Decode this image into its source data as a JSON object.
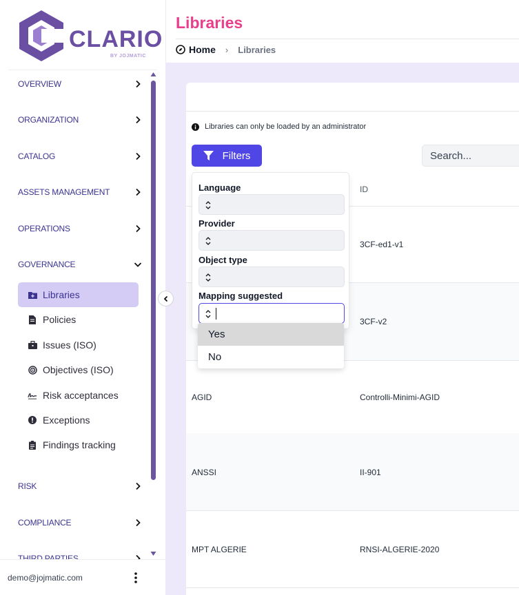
{
  "brand": {
    "name": "CLARIO",
    "tagline": "BY JOJMATIC",
    "color": "#6b4fa3"
  },
  "sidebar": {
    "sections": [
      {
        "label": "OVERVIEW",
        "expanded": false
      },
      {
        "label": "ORGANIZATION",
        "expanded": false
      },
      {
        "label": "CATALOG",
        "expanded": false
      },
      {
        "label": "ASSETS MANAGEMENT",
        "expanded": false
      },
      {
        "label": "OPERATIONS",
        "expanded": false
      },
      {
        "label": "GOVERNANCE",
        "expanded": true
      },
      {
        "label": "RISK",
        "expanded": false
      },
      {
        "label": "COMPLIANCE",
        "expanded": false
      },
      {
        "label": "THIRD PARTIES",
        "expanded": false
      }
    ],
    "governance_items": [
      {
        "label": "Libraries",
        "icon": "folder-plus-icon",
        "active": true
      },
      {
        "label": "Policies",
        "icon": "file-icon",
        "active": false
      },
      {
        "label": "Issues (ISO)",
        "icon": "briefcase-icon",
        "active": false
      },
      {
        "label": "Objectives (ISO)",
        "icon": "target-icon",
        "active": false
      },
      {
        "label": "Risk acceptances",
        "icon": "signature-icon",
        "active": false
      },
      {
        "label": "Exceptions",
        "icon": "exclamation-circle-icon",
        "active": false
      },
      {
        "label": "Findings tracking",
        "icon": "clipboard-icon",
        "active": false
      }
    ],
    "user_email": "demo@jojmatic.com"
  },
  "header": {
    "title": "Libraries",
    "breadcrumb": {
      "home": "Home",
      "separator": "›",
      "current": "Libraries"
    }
  },
  "main": {
    "info_text": "Libraries can only be loaded by an administrator",
    "filters_label": "Filters",
    "search_placeholder": "Search...",
    "columns": {
      "id": "ID"
    },
    "rows": [
      {
        "provider": "",
        "id": "3CF-ed1-v1"
      },
      {
        "provider": "",
        "id": "3CF-v2"
      },
      {
        "provider": "AGID",
        "id": "Controlli-Minimi-AGID"
      },
      {
        "provider": "ANSSI",
        "id": "II-901"
      },
      {
        "provider": "MPT ALGERIE",
        "id": "RNSI-ALGERIE-2020"
      }
    ]
  },
  "filters": {
    "fields": [
      {
        "label": "Language",
        "value": ""
      },
      {
        "label": "Provider",
        "value": ""
      },
      {
        "label": "Object type",
        "value": ""
      },
      {
        "label": "Mapping suggested",
        "value": "",
        "focused": true
      }
    ],
    "mapping_options": [
      "Yes",
      "No"
    ],
    "highlighted_option": "Yes"
  },
  "colors": {
    "accent": "#4f46e5",
    "title": "#e83e8c",
    "nav_text": "#3b3390",
    "active_bg": "#d4ccf5",
    "main_bg": "#ede9fb"
  }
}
